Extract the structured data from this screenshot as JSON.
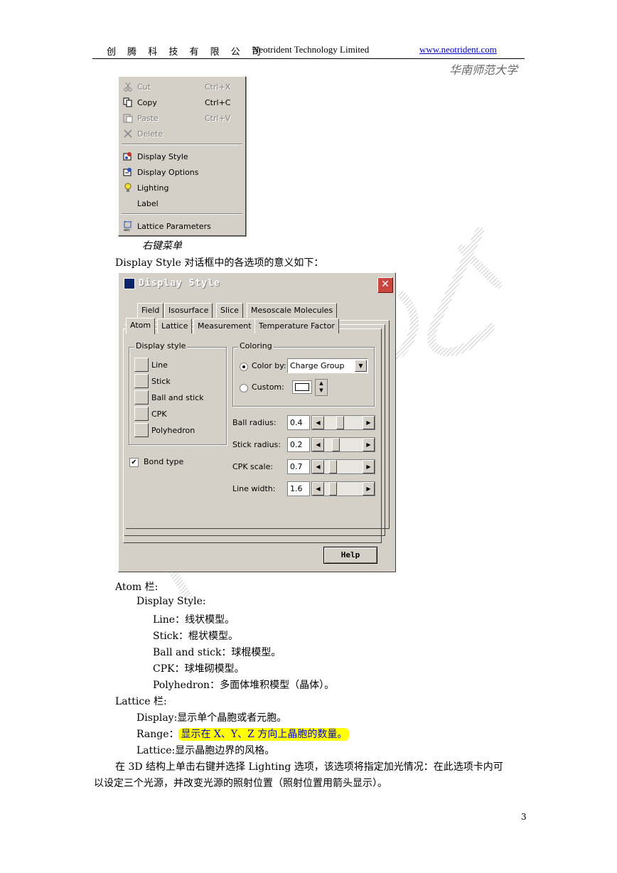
{
  "header": {
    "company_cn": "创 腾 科 技 有 限 公 司",
    "company_en": "Neotrident Technology Limited",
    "url": "www.neotrident.com",
    "subtitle": "华南师范大学"
  },
  "context_menu": {
    "caption": "右键菜单",
    "items": [
      {
        "label": "Cut",
        "shortcut": "Ctrl+X",
        "icon": "scissors-icon",
        "disabled": true
      },
      {
        "label": "Copy",
        "shortcut": "Ctrl+C",
        "icon": "copy-icon",
        "disabled": false
      },
      {
        "label": "Paste",
        "shortcut": "Ctrl+V",
        "icon": "paste-icon",
        "disabled": true
      },
      {
        "label": "Delete",
        "shortcut": "",
        "icon": "delete-icon",
        "disabled": true
      },
      {
        "label": "Display Style",
        "shortcut": "",
        "icon": "display-style-icon",
        "disabled": false
      },
      {
        "label": "Display Options",
        "shortcut": "",
        "icon": "display-options-icon",
        "disabled": false
      },
      {
        "label": "Lighting",
        "shortcut": "",
        "icon": "lightbulb-icon",
        "disabled": false
      },
      {
        "label": "Label",
        "shortcut": "",
        "icon": "",
        "disabled": false
      },
      {
        "label": "Lattice Parameters",
        "shortcut": "",
        "icon": "lattice-icon",
        "disabled": false
      }
    ]
  },
  "intro_line": "Display Style 对话框中的各选项的意义如下：",
  "dialog": {
    "title": "Display Style",
    "tabs_row1": [
      "Field",
      "Isosurface",
      "Slice",
      "Mesoscale Molecules"
    ],
    "tabs_row2": [
      "Atom",
      "Lattice",
      "Measurement",
      "Temperature Factor"
    ],
    "display_style_label": "Display style",
    "display_styles": [
      "Line",
      "Stick",
      "Ball and stick",
      "CPK",
      "Polyhedron"
    ],
    "bond_type_label": "Bond type",
    "bond_type_checked": true,
    "coloring_label": "Coloring",
    "color_by_label": "Color by:",
    "color_by_value": "Charge Group",
    "custom_label": "Custom:",
    "ball_radius_label": "Ball radius:",
    "ball_radius": "0.4",
    "stick_radius_label": "Stick radius:",
    "stick_radius": "0.2",
    "cpk_scale_label": "CPK scale:",
    "cpk_scale": "0.7",
    "line_width_label": "Line width:",
    "line_width": "1.6",
    "help_label": "Help"
  },
  "body": {
    "atom_heading": "Atom 栏:",
    "display_style_heading": "Display Style:",
    "items": [
      "Line：线状模型。",
      "Stick：棍状模型。",
      "Ball and stick：球棍模型。",
      "CPK：球堆砌模型。",
      "Polyhedron：多面体堆积模型（晶体）。"
    ],
    "lattice_heading": "Lattice 栏:",
    "lattice_display": "Display:显示单个晶胞或者元胞。",
    "range_label": "Range：",
    "range_text": "显示在 X、Y、Z 方向上晶胞的数量。",
    "lattice_lattice": "Lattice:显示晶胞边界的风格。",
    "para_line1": "在 3D 结构上单击右键并选择 Lighting 选项，该选项将指定加光情况：在此选项卡内可",
    "para_line2": "以设定三个光源，并改变光源的照射位置（照射位置用箭头显示）。"
  },
  "page_number": "3",
  "colors": {
    "link": "#0000cc",
    "highlight": "#ffff00",
    "dialog_bg": "#d4d0c8",
    "close": "#c8463e"
  }
}
